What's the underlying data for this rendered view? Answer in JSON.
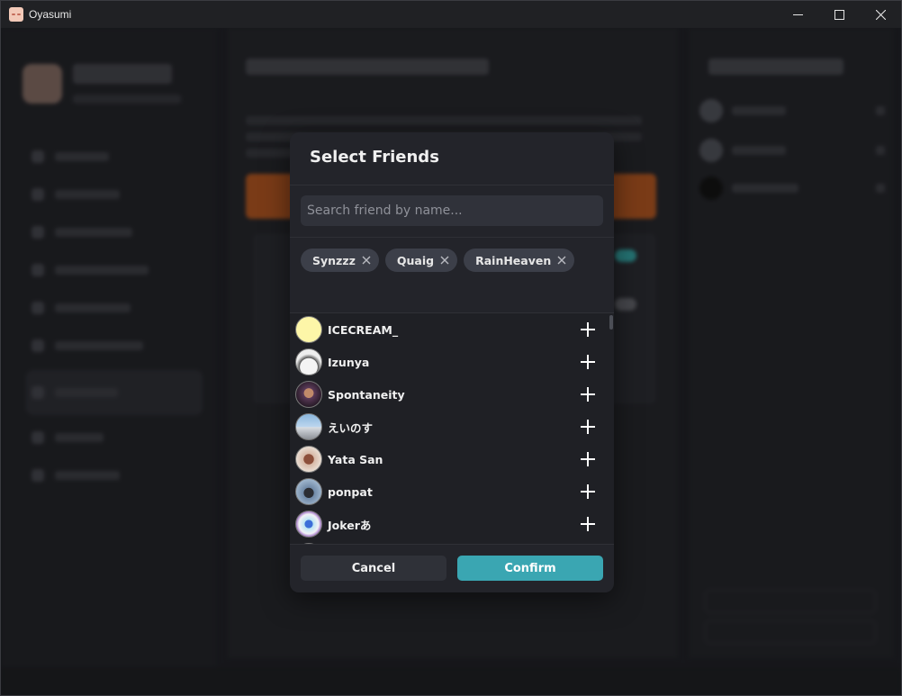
{
  "window": {
    "title": "Oyasumi"
  },
  "modal": {
    "title": "Select Friends",
    "search_placeholder": "Search friend by name...",
    "selected_chips": [
      "Synzzz",
      "Quaig",
      "RainHeaven"
    ],
    "friends": [
      {
        "name": "ICECREAM_",
        "avatar": "yellow-avatar"
      },
      {
        "name": "Izunya",
        "avatar": "white-avatar"
      },
      {
        "name": "Spontaneity",
        "avatar": "character-avatar"
      },
      {
        "name": "えいのす",
        "avatar": "sky-avatar"
      },
      {
        "name": "Yata San",
        "avatar": "figure-avatar"
      },
      {
        "name": "ponpat",
        "avatar": "figure-avatar"
      },
      {
        "name": "Jokerあ",
        "avatar": "sticker-avatar"
      }
    ],
    "cancel_label": "Cancel",
    "confirm_label": "Confirm"
  },
  "colors": {
    "accent": "#3aa6b2",
    "modal_bg": "#23242a",
    "chip_bg": "#3c3f49"
  }
}
